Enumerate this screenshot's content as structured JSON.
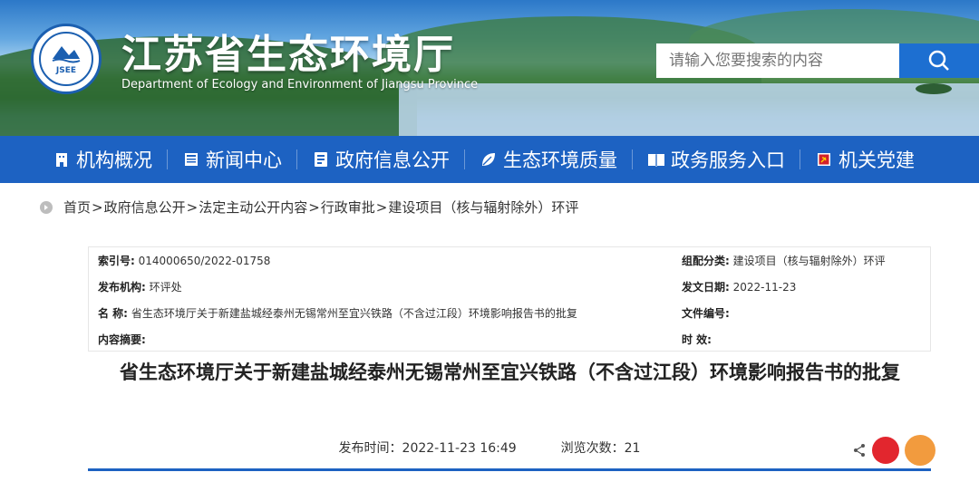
{
  "header": {
    "title": "江苏省生态环境厅",
    "subtitle": "Department of Ecology and Environment of Jiangsu Province",
    "logo_text": "JSEE",
    "search_placeholder": "请输入您要搜索的内容",
    "search_icon": "search-icon"
  },
  "nav": {
    "items": [
      {
        "label": "机构概况",
        "icon": "building-icon"
      },
      {
        "label": "新闻中心",
        "icon": "newspaper-icon"
      },
      {
        "label": "政府信息公开",
        "icon": "info-board-icon"
      },
      {
        "label": "生态环境质量",
        "icon": "leaf-icon"
      },
      {
        "label": "政务服务入口",
        "icon": "book-icon"
      },
      {
        "label": "机关党建",
        "icon": "party-flag-icon"
      }
    ]
  },
  "breadcrumb": [
    "首页",
    "政府信息公开",
    "法定主动公开内容",
    "行政审批",
    "建设项目（核与辐射除外）环评"
  ],
  "meta": {
    "index_label": "索引号:",
    "index_value": "014000650/2022-01758",
    "category_label": "组配分类:",
    "category_value": "建设项目（核与辐射除外）环评",
    "publisher_label": "发布机构:",
    "publisher_value": "环评处",
    "date_label": "发文日期:",
    "date_value": "2022-11-23",
    "name_label": "名  称:",
    "name_value": "省生态环境厅关于新建盐城经泰州无锡常州至宜兴铁路（不含过江段）环境影响报告书的批复",
    "docno_label": "文件编号:",
    "docno_value": "",
    "summary_label": "内容摘要:",
    "summary_value": "",
    "validity_label": "时  效:",
    "validity_value": ""
  },
  "article": {
    "title": "省生态环境厅关于新建盐城经泰州无锡常州至宜兴铁路（不含过江段）环境影响报告书的批复",
    "publish_time_label": "发布时间：",
    "publish_time": "2022-11-23 16:49",
    "views_label": "浏览次数：",
    "views": "21"
  },
  "colors": {
    "nav_bg": "#1d62c2",
    "search_btn": "#1d6fd1",
    "divider": "#1d62c2"
  }
}
